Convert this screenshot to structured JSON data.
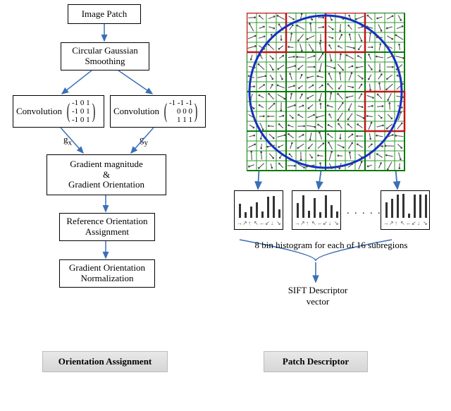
{
  "flow": {
    "image_patch": "Image Patch",
    "gaussian": "Circular Gaussian\nSmoothing",
    "conv_x_label": "Convolution",
    "conv_x_matrix_r1": "-1  0  1",
    "conv_x_matrix_r2": "-1  0  1",
    "conv_x_matrix_r3": "-1  0  1",
    "conv_y_label": "Convolution",
    "conv_y_matrix_r1": "-1 -1 -1",
    "conv_y_matrix_r2": " 0  0  0",
    "conv_y_matrix_r3": " 1  1  1",
    "gx": "g",
    "gx_sub": "x",
    "gy": "g",
    "gy_sub": "y",
    "grad": "Gradient magnitude\n&\nGradient Orientation",
    "ref": "Reference Orientation\nAssignment",
    "norm": "Gradient Orientation\nNormalization",
    "orient_label": "Orientation Assignment",
    "patch_label": "Patch Descriptor"
  },
  "right": {
    "hist_caption": "8 bin histogram for each of 16 subregions",
    "dots": ". . . . .",
    "sift": "SIFT Descriptor\nvector"
  }
}
